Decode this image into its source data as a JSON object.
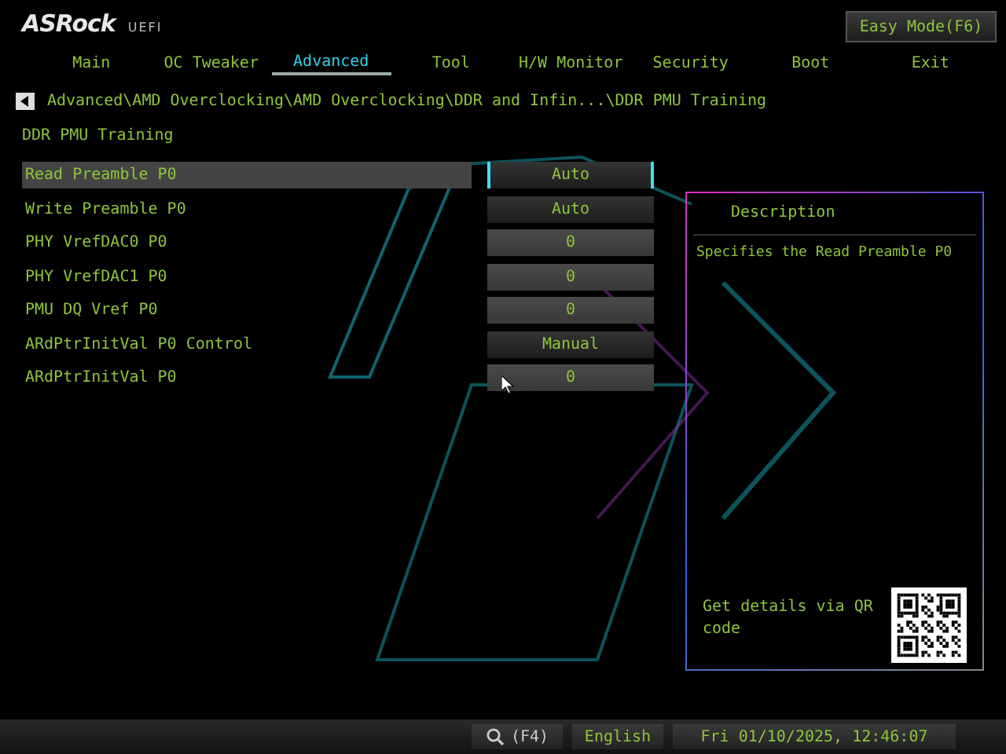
{
  "header": {
    "logo": "ASRock",
    "logo_suffix": "UEFI",
    "easy_mode_button": "Easy Mode(F6)"
  },
  "tabs": [
    {
      "label": "Main",
      "selected": false
    },
    {
      "label": "OC Tweaker",
      "selected": false
    },
    {
      "label": "Advanced",
      "selected": true
    },
    {
      "label": "Tool",
      "selected": false
    },
    {
      "label": "H/W Monitor",
      "selected": false
    },
    {
      "label": "Security",
      "selected": false
    },
    {
      "label": "Boot",
      "selected": false
    },
    {
      "label": "Exit",
      "selected": false
    }
  ],
  "breadcrumb": "Advanced\\AMD Overclocking\\AMD Overclocking\\DDR and Infin...\\DDR PMU Training",
  "section_title": "DDR PMU Training",
  "settings": [
    {
      "label": "Read Preamble P0",
      "value": "Auto",
      "kind": "option",
      "selected": true
    },
    {
      "label": "Write Preamble P0",
      "value": "Auto",
      "kind": "option",
      "selected": false
    },
    {
      "label": "PHY VrefDAC0 P0",
      "value": "0",
      "kind": "number",
      "selected": false
    },
    {
      "label": "PHY VrefDAC1 P0",
      "value": "0",
      "kind": "number",
      "selected": false
    },
    {
      "label": "PMU DQ Vref P0",
      "value": "0",
      "kind": "number",
      "selected": false
    },
    {
      "label": "ARdPtrInitVal P0 Control",
      "value": "Manual",
      "kind": "option",
      "selected": false
    },
    {
      "label": "ARdPtrInitVal P0",
      "value": "0",
      "kind": "number",
      "selected": false
    }
  ],
  "description_panel": {
    "title": "Description",
    "text": "Specifies the Read Preamble P0",
    "qr_hint": "Get details via QR code"
  },
  "status_bar": {
    "search_key": "(F4)",
    "language": "English",
    "datetime": "Fri 01/10/2025, 12:46:07"
  }
}
